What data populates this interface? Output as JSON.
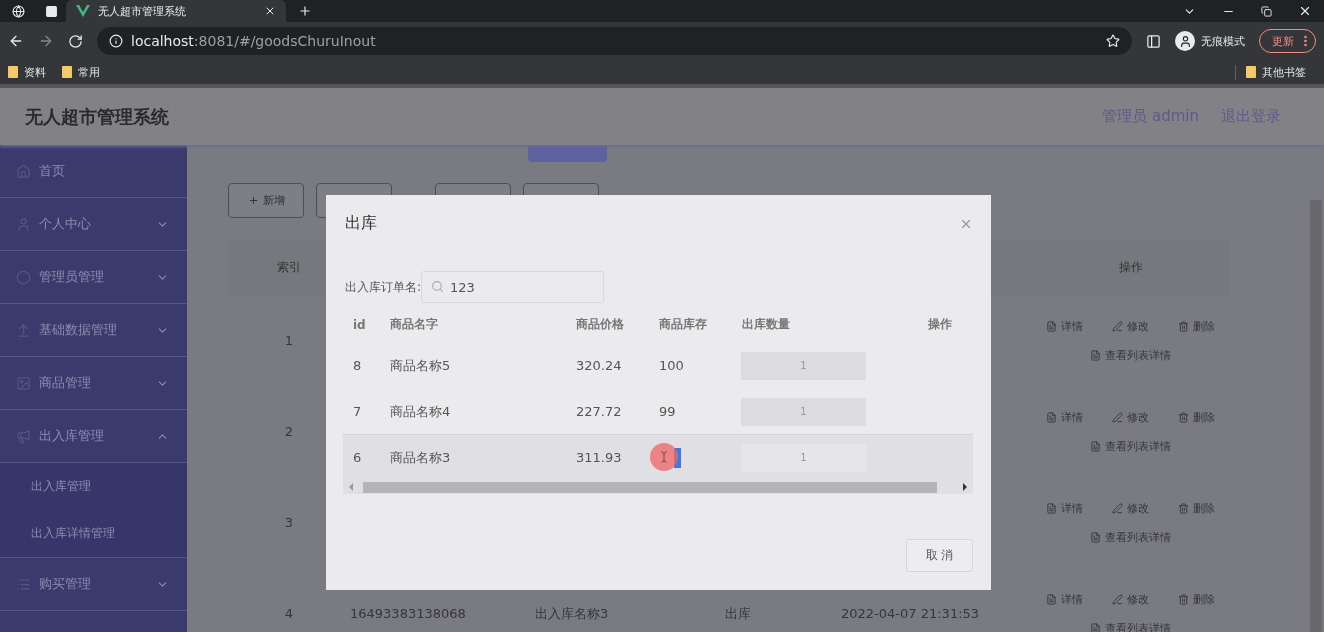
{
  "browser": {
    "tab_title": "无人超市管理系统",
    "url_host": "localhost",
    "url_path": ":8081/#/goodsChuruInout",
    "profile_label": "无痕模式",
    "update_button": "更新",
    "bookmarks": [
      "资料",
      "常用"
    ],
    "other_bookmarks": "其他书签"
  },
  "app": {
    "title": "无人超市管理系统",
    "user": "管理员 admin",
    "logout": "退出登录"
  },
  "sidebar": {
    "items": [
      {
        "label": "首页",
        "kind": "link"
      },
      {
        "label": "个人中心",
        "kind": "menu",
        "expanded": false
      },
      {
        "label": "管理员管理",
        "kind": "menu",
        "expanded": false
      },
      {
        "label": "基础数据管理",
        "kind": "menu",
        "expanded": false
      },
      {
        "label": "商品管理",
        "kind": "menu",
        "expanded": false
      },
      {
        "label": "出入库管理",
        "kind": "menu",
        "expanded": true,
        "children": [
          {
            "label": "出入库管理"
          },
          {
            "label": "出入库详情管理"
          }
        ]
      },
      {
        "label": "购买管理",
        "kind": "menu",
        "expanded": false
      }
    ]
  },
  "toolbar": {
    "add_button": "新增"
  },
  "table": {
    "columns": [
      {
        "label": "索引"
      },
      {
        "label": "操作"
      }
    ],
    "rows": [
      {
        "index": "1",
        "actions": [
          {
            "kind": "detail",
            "label": "详情"
          },
          {
            "kind": "edit",
            "label": "修改"
          },
          {
            "kind": "delete",
            "label": "删除"
          },
          {
            "kind": "list",
            "label": "查看列表详情"
          }
        ]
      },
      {
        "index": "2",
        "actions": [
          {
            "kind": "detail",
            "label": "详情"
          },
          {
            "kind": "edit",
            "label": "修改"
          },
          {
            "kind": "delete",
            "label": "删除"
          },
          {
            "kind": "list",
            "label": "查看列表详情"
          }
        ]
      },
      {
        "index": "3",
        "actions": [
          {
            "kind": "detail",
            "label": "详情"
          },
          {
            "kind": "edit",
            "label": "修改"
          },
          {
            "kind": "delete",
            "label": "删除"
          },
          {
            "kind": "list",
            "label": "查看列表详情"
          }
        ]
      },
      {
        "index": "4",
        "cells": [
          "16493383138068",
          "出入库名称3",
          "出库",
          "2022-04-07 21:31:53"
        ],
        "actions": [
          {
            "kind": "detail",
            "label": "详情"
          },
          {
            "kind": "edit",
            "label": "修改"
          },
          {
            "kind": "delete",
            "label": "删除"
          },
          {
            "kind": "list",
            "label": "查看列表详情"
          }
        ]
      }
    ]
  },
  "dialog": {
    "title": "出库",
    "search_label": "出入库订单名:",
    "search_value": "123",
    "columns": [
      "id",
      "商品名字",
      "商品价格",
      "商品库存",
      "出库数量",
      "操作"
    ],
    "rows": [
      {
        "id": "8",
        "name": "商品名称5",
        "price": "320.24",
        "stock": "100",
        "quantity": "1",
        "hovered": false
      },
      {
        "id": "7",
        "name": "商品名称4",
        "price": "227.72",
        "stock": "99",
        "quantity": "1",
        "hovered": false
      },
      {
        "id": "6",
        "name": "商品名称3",
        "price": "311.93",
        "quantity": "1",
        "hovered": true
      }
    ],
    "cancel_button": "取 消"
  }
}
